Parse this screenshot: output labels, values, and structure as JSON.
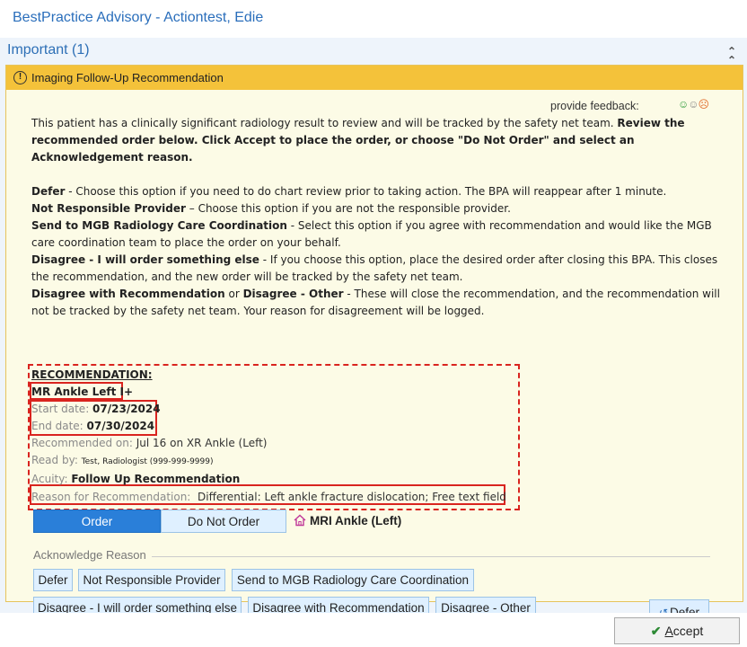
{
  "window": {
    "title": "BestPractice Advisory - Actiontest, Edie"
  },
  "section": {
    "title": "Important (1)",
    "collapse_icon": "double-chevron-up-icon"
  },
  "card": {
    "title": "Imaging Follow-Up Recommendation",
    "feedback_label": "provide feedback:",
    "intro_plain": "This patient has a clinically significant radiology result to review and will be tracked by the safety net team. ",
    "intro_bold": "Review the recommended order below. Click Accept to place the order, or choose \"Do Not Order\" and select an Acknowledgement reason.",
    "options": [
      {
        "term": "Defer",
        "sep": " - ",
        "desc": "Choose this option if you need to do chart review prior to taking action. The BPA will reappear after 1 minute."
      },
      {
        "term": "Not Responsible Provider",
        "sep": " – ",
        "desc": "Choose this option if you are not the responsible provider."
      },
      {
        "term": "Send to MGB Radiology Care Coordination",
        "sep": " - ",
        "desc": "Select this option if you agree with recommendation and would like the MGB care coordination team to place the order on your behalf."
      },
      {
        "term": "Disagree - I will order something else",
        "sep": " - ",
        "desc": "If you choose this option, place the desired order after closing this BPA. This closes the recommendation, and the new order will be tracked by the safety net team."
      }
    ],
    "option5": {
      "term_a": "Disagree with Recommendation",
      "or": " or ",
      "term_b": "Disagree - Other",
      "sep": " - ",
      "desc": "These will close the recommendation, and the recommendation will not be tracked by the safety net team. Your reason for disagreement will be logged."
    }
  },
  "recommendation": {
    "heading": "RECOMMENDATION:",
    "order_name": "MR Ankle Left I+",
    "start_label": "Start date: ",
    "start_value": "07/23/2024",
    "end_label": "End date: ",
    "end_value": "07/30/2024",
    "recommended_on_label": "Recommended on: ",
    "recommended_on_value": "Jul 16 on XR Ankle (Left)",
    "read_by_label": "Read by: ",
    "read_by_value": "Test, Radiologist (999-999-9999)",
    "acuity_label": "Acuity: ",
    "acuity_value": "Follow Up Recommendation",
    "reason_label": "Reason for Recommendation:",
    "reason_value": "Differential: Left ankle fracture dislocation; Free text field"
  },
  "order_buttons": {
    "order": "Order",
    "do_not_order": "Do Not Order",
    "mri_label": "MRI Ankle (Left)"
  },
  "acknowledge": {
    "title": "Acknowledge Reason",
    "row1": [
      "Defer",
      "Not Responsible Provider",
      "Send to MGB Radiology Care Coordination"
    ],
    "row2": [
      "Disagree - I will order something else",
      "Disagree with Recommendation",
      "Disagree - Other"
    ],
    "defer_right": "Defer"
  },
  "footer": {
    "accept_prefix": "",
    "accept_underlined": "A",
    "accept_rest": "ccept"
  },
  "colors": {
    "accent": "#2a6ebb",
    "header_yellow": "#f4c23a",
    "card_bg": "#fcfbe6",
    "highlight_red": "#d9241f",
    "order_blue": "#2a7fd9"
  }
}
